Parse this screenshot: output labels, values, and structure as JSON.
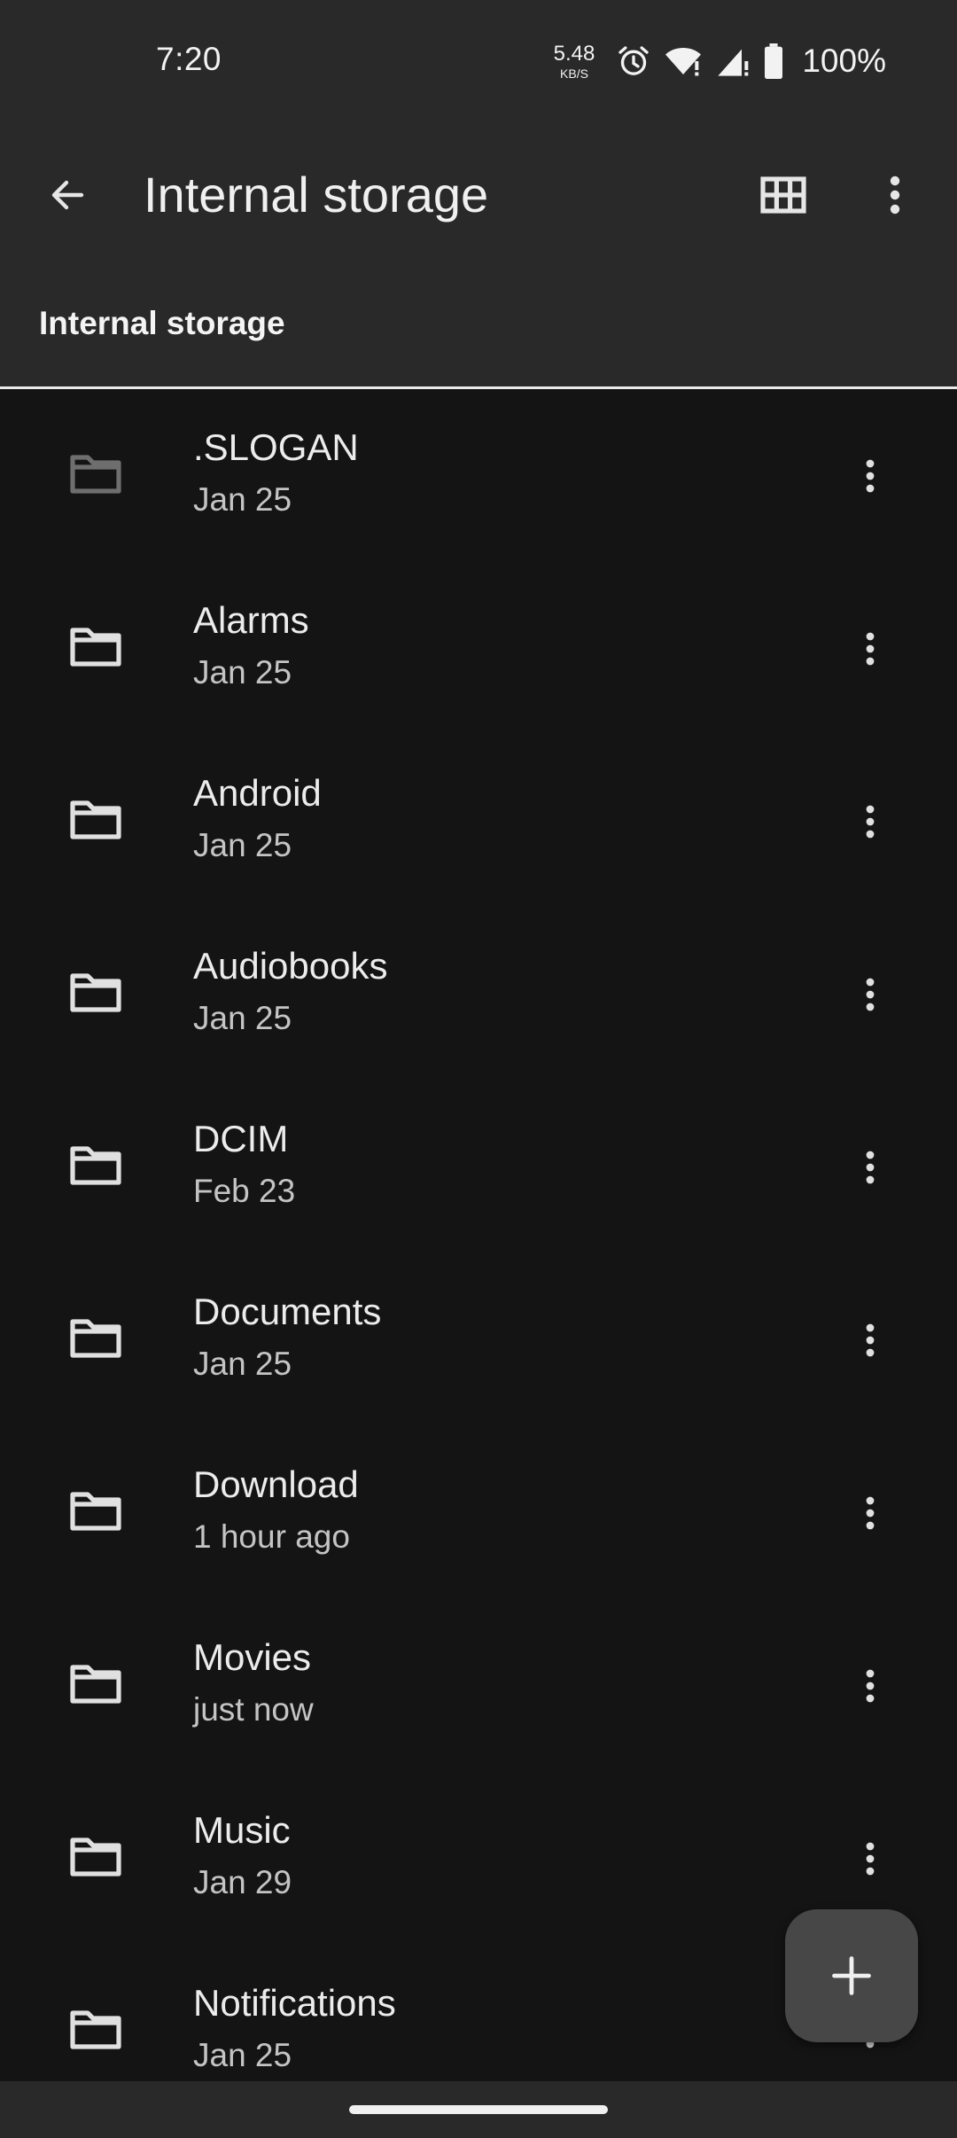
{
  "status_bar": {
    "time": "7:20",
    "net_speed": "5.48",
    "net_unit": "KB/S",
    "battery": "100%",
    "icons": [
      "alarm-icon",
      "wifi-icon",
      "signal-icon",
      "battery-icon"
    ]
  },
  "app_bar": {
    "title": "Internal storage",
    "icons": [
      "back-arrow-icon",
      "grid-view-icon",
      "more-vert-icon"
    ]
  },
  "breadcrumb": {
    "label": "Internal storage"
  },
  "files": [
    {
      "name": ".SLOGAN",
      "date": "Jan 25",
      "hidden": true
    },
    {
      "name": "Alarms",
      "date": "Jan 25",
      "hidden": false
    },
    {
      "name": "Android",
      "date": "Jan 25",
      "hidden": false
    },
    {
      "name": "Audiobooks",
      "date": "Jan 25",
      "hidden": false
    },
    {
      "name": "DCIM",
      "date": "Feb 23",
      "hidden": false
    },
    {
      "name": "Documents",
      "date": "Jan 25",
      "hidden": false
    },
    {
      "name": "Download",
      "date": "1 hour ago",
      "hidden": false
    },
    {
      "name": "Movies",
      "date": "just now",
      "hidden": false
    },
    {
      "name": "Music",
      "date": "Jan 29",
      "hidden": false
    },
    {
      "name": "Notifications",
      "date": "Jan 25",
      "hidden": false
    }
  ],
  "fab": {
    "icon": "add-icon"
  },
  "colors": {
    "background": "#141414",
    "bar": "#292929",
    "text_primary": "#ececec",
    "text_secondary": "#c4c4c4",
    "icon": "#e0e0e0",
    "icon_hidden": "#6e6e6e",
    "fab": "#474747"
  }
}
